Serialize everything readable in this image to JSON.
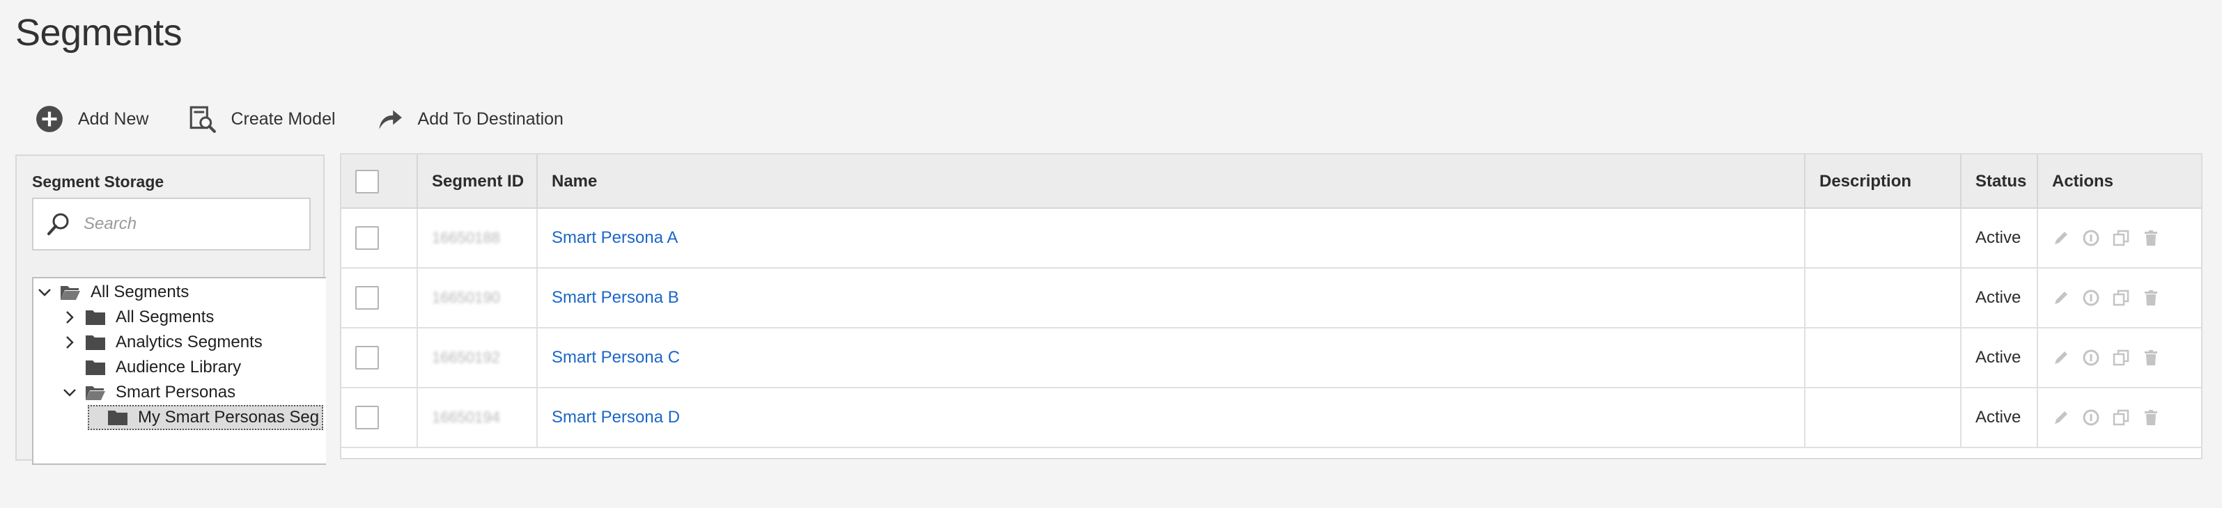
{
  "page": {
    "title": "Segments"
  },
  "toolbar": {
    "add_new": "Add New",
    "create_model": "Create Model",
    "add_to_destination": "Add To Destination"
  },
  "segment_storage": {
    "title": "Segment Storage",
    "search_placeholder": "Search",
    "tree": [
      {
        "label": "All Segments",
        "level": 0,
        "expanded": true
      },
      {
        "label": "All Segments",
        "level": 1,
        "expanded": false
      },
      {
        "label": "Analytics Segments",
        "level": 1,
        "expanded": false
      },
      {
        "label": "Audience Library",
        "level": 1,
        "expanded": null
      },
      {
        "label": "Smart Personas",
        "level": 1,
        "expanded": true
      },
      {
        "label": "My Smart Personas Seg",
        "level": 2,
        "expanded": null,
        "selected": true
      }
    ]
  },
  "table": {
    "columns": {
      "segment_id": "Segment ID",
      "name": "Name",
      "description": "Description",
      "status": "Status",
      "actions": "Actions"
    },
    "rows": [
      {
        "segment_id": "16650188",
        "name": "Smart Persona A",
        "description": "",
        "status": "Active"
      },
      {
        "segment_id": "16650190",
        "name": "Smart Persona B",
        "description": "",
        "status": "Active"
      },
      {
        "segment_id": "16650192",
        "name": "Smart Persona C",
        "description": "",
        "status": "Active"
      },
      {
        "segment_id": "16650194",
        "name": "Smart Persona D",
        "description": "",
        "status": "Active"
      }
    ]
  },
  "colors": {
    "link": "#1b66c9",
    "background": "#f4f4f4",
    "header_bg": "#ececec",
    "icon_dark": "#4b4b4b",
    "icon_disabled": "#c4c4c4"
  },
  "icons": {
    "add_new": "plus-circle-icon",
    "create_model": "model-search-icon",
    "add_to_destination": "share-arrow-icon",
    "search": "magnifier-icon",
    "actions": [
      "edit-icon",
      "info-icon",
      "copy-icon",
      "delete-icon"
    ]
  }
}
